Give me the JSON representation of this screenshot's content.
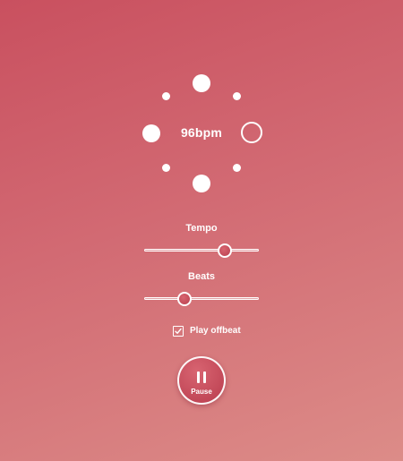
{
  "metronome": {
    "bpm_display": "96bpm",
    "tempo_bpm": 96,
    "beats_count": 4,
    "active_beat": 2
  },
  "controls": {
    "tempo_label": "Tempo",
    "tempo_fraction": 0.7,
    "beats_label": "Beats",
    "beats_fraction": 0.35,
    "offbeat_label": "Play offbeat",
    "offbeat_checked": true
  },
  "playback": {
    "button_label": "Pause",
    "icon": "pause-icon"
  },
  "colors": {
    "background_start": "#c9505f",
    "background_end": "#dc8c88",
    "accent": "#ffffff",
    "button": "#c24a5a"
  }
}
